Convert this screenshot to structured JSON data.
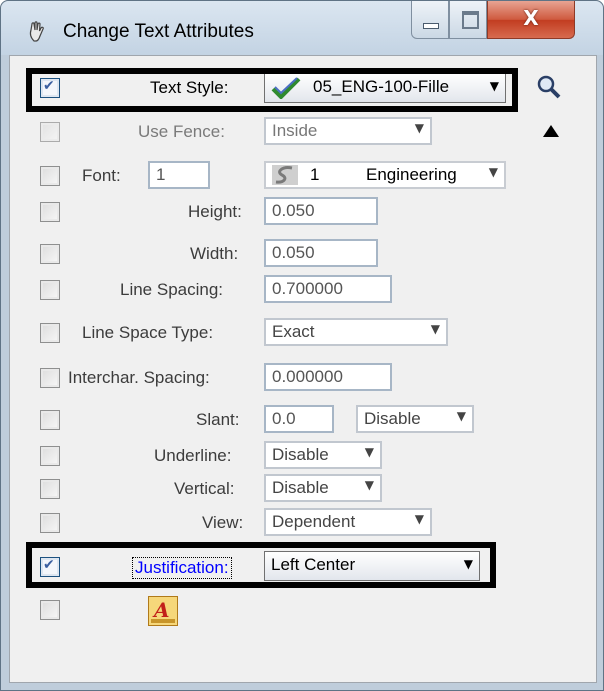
{
  "window": {
    "title": "Change Text Attributes",
    "close_label": "X"
  },
  "rows": {
    "text_style": {
      "label": "Text Style:",
      "value": "05_ENG-100-Fille",
      "checked": true
    },
    "use_fence": {
      "label": "Use Fence:",
      "value": "Inside"
    },
    "font": {
      "label": "Font:",
      "number": "1",
      "dropdown_num": "1",
      "dropdown_name": "Engineering"
    },
    "height": {
      "label": "Height:",
      "value": "0.050"
    },
    "width": {
      "label": "Width:",
      "value": "0.050"
    },
    "line_spacing": {
      "label": "Line Spacing:",
      "value": "0.700000"
    },
    "line_space_type": {
      "label": "Line Space Type:",
      "value": "Exact"
    },
    "interchar_spacing": {
      "label": "Interchar. Spacing:",
      "value": "0.000000"
    },
    "slant": {
      "label": "Slant:",
      "value": "0.0",
      "mode": "Disable"
    },
    "underline": {
      "label": "Underline:",
      "value": "Disable"
    },
    "vertical": {
      "label": "Vertical:",
      "value": "Disable"
    },
    "view": {
      "label": "View:",
      "value": "Dependent"
    },
    "justification": {
      "label": "Justification:",
      "value": "Left Center",
      "checked": true
    }
  },
  "icons": {
    "title": "hand-tool-icon",
    "search": "magnifier-icon",
    "collapse": "triangle-up-icon",
    "font_preview": "text-font-icon"
  },
  "colors": {
    "highlight": "#000000",
    "accent_link": "#0000ff",
    "checkbox_check": "#3b5fa0"
  }
}
